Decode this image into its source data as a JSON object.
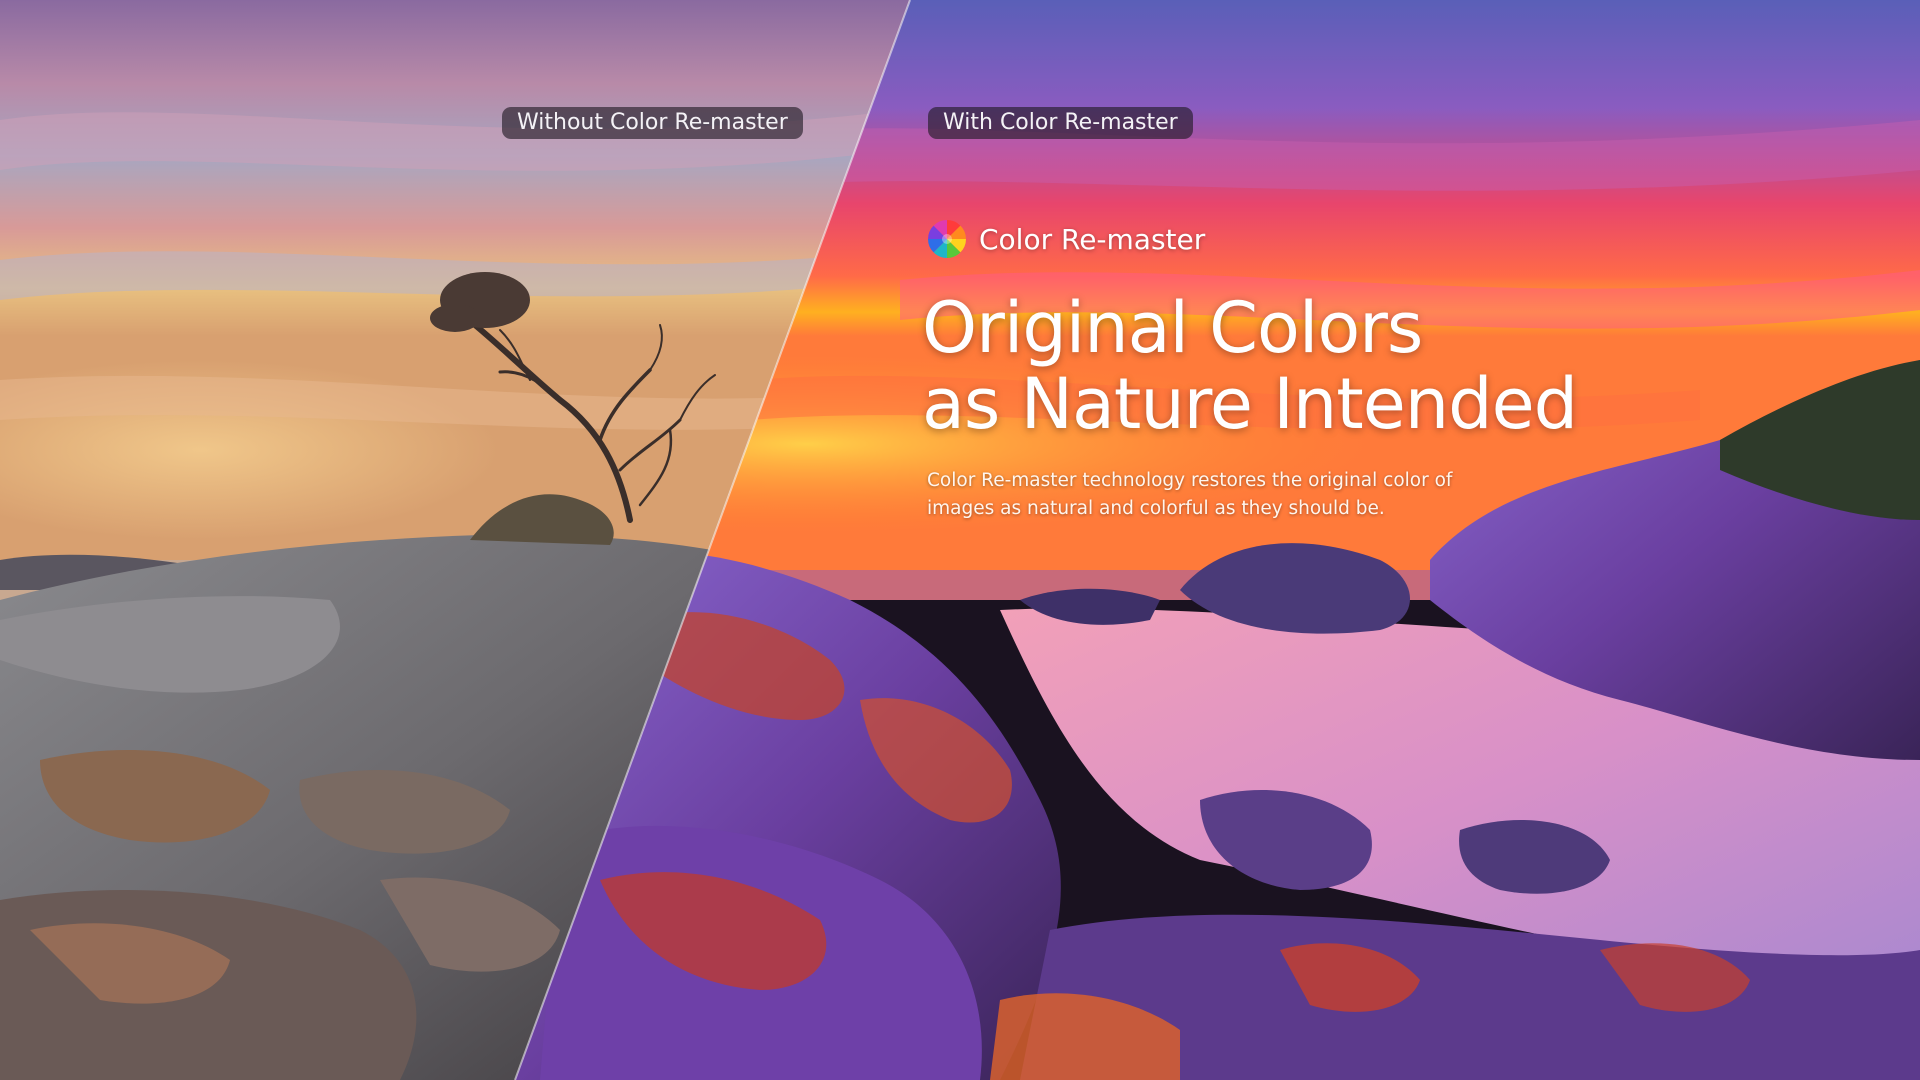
{
  "comparison": {
    "left_label": "Without Color Re-master",
    "right_label": "With Color Re-master"
  },
  "brand": {
    "name": "Color Re-master",
    "logo_icon": "color-wheel-icon"
  },
  "headline": {
    "line1": "Original Colors",
    "line2": "as Nature Intended"
  },
  "description": "Color Re-master technology restores the original color of images as natural and colorful as they should be.",
  "colors": {
    "label_background": "#1e1822",
    "text": "#ffffff",
    "sky_vivid": "#e8456c",
    "horizon_vivid": "#ffb020",
    "rock_vivid": "#7a4fb0",
    "lichen_vivid": "#c2442e",
    "sky_muted": "#9a8aa0",
    "horizon_muted": "#e2b070",
    "rock_muted": "#6f6d70"
  }
}
